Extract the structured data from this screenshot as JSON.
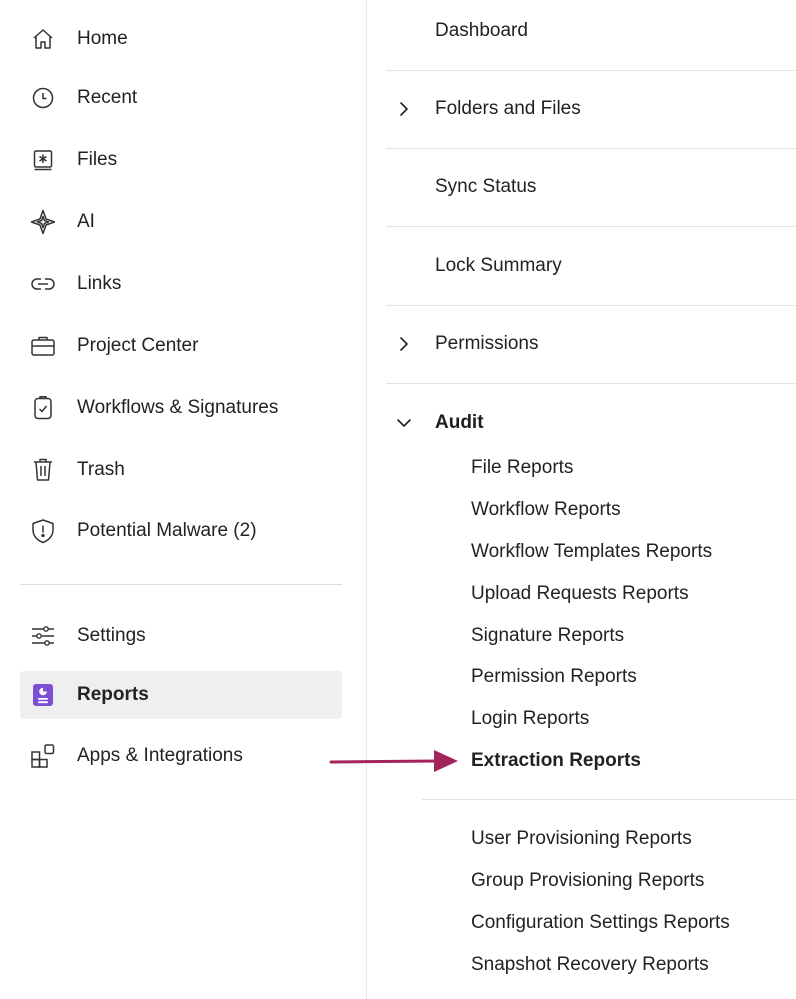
{
  "sidebar": {
    "items": [
      {
        "label": "Home",
        "icon": "home-icon"
      },
      {
        "label": "Recent",
        "icon": "clock-icon"
      },
      {
        "label": "Files",
        "icon": "files-icon"
      },
      {
        "label": "AI",
        "icon": "sparkle-icon"
      },
      {
        "label": "Links",
        "icon": "link-icon"
      },
      {
        "label": "Project Center",
        "icon": "briefcase-icon"
      },
      {
        "label": "Workflows & Signatures",
        "icon": "clipboard-check-icon"
      },
      {
        "label": "Trash",
        "icon": "trash-icon"
      },
      {
        "label": "Potential Malware (2)",
        "icon": "shield-alert-icon"
      }
    ],
    "bottom_items": [
      {
        "label": "Settings",
        "icon": "sliders-icon"
      },
      {
        "label": "Reports",
        "icon": "reports-icon",
        "active": true
      },
      {
        "label": "Apps & Integrations",
        "icon": "apps-icon"
      }
    ]
  },
  "reports_menu": {
    "sections": [
      {
        "label": "Dashboard",
        "expandable": false
      },
      {
        "label": "Folders and Files",
        "expandable": true,
        "expanded": false
      },
      {
        "label": "Sync Status",
        "expandable": false
      },
      {
        "label": "Lock Summary",
        "expandable": false
      },
      {
        "label": "Permissions",
        "expandable": true,
        "expanded": false
      }
    ],
    "audit": {
      "label": "Audit",
      "expanded": true,
      "items": [
        "File Reports",
        "Workflow Reports",
        "Workflow Templates Reports",
        "Upload Requests Reports",
        "Signature Reports",
        "Permission Reports",
        "Login Reports",
        "Extraction Reports"
      ],
      "highlighted": "Extraction Reports",
      "more_items": [
        "User Provisioning Reports",
        "Group Provisioning Reports",
        "Configuration Settings Reports",
        "Snapshot Recovery Reports"
      ]
    }
  },
  "colors": {
    "active_bg": "#efefef",
    "reports_icon": "#7b4fd6",
    "annotation_arrow": "#a3245a",
    "divider": "#e3e3e3"
  }
}
